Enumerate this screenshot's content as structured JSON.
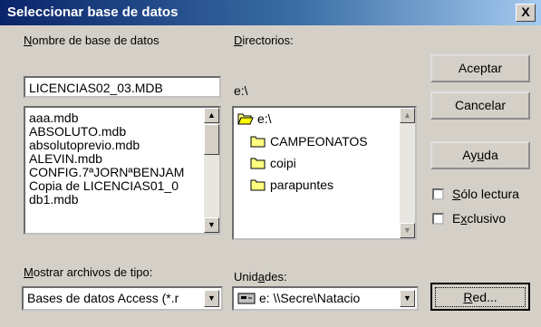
{
  "window": {
    "title": "Seleccionar base de datos",
    "close_label": "X"
  },
  "labels": {
    "db_name_u": "N",
    "db_name_rest": "ombre de base de datos",
    "dirs_u": "D",
    "dirs_rest": "irectorios:",
    "filetype_u": "M",
    "filetype_rest": "ostrar archivos de tipo:",
    "drives_pre": "Unid",
    "drives_u": "a",
    "drives_post": "des:"
  },
  "db_name_field": {
    "value": "LICENCIAS02_03.MDB"
  },
  "current_dir": "e:\\",
  "file_list": [
    "aaa.mdb",
    "ABSOLUTO.mdb",
    "absolutoprevio.mdb",
    "ALEVIN.mdb",
    "CONFIG.7ªJORNªBENJAM",
    "Copia de LICENCIAS01_0",
    "db1.mdb"
  ],
  "directories": [
    {
      "name": "e:\\",
      "icon": "open-folder-icon"
    },
    {
      "name": "CAMPEONATOS",
      "icon": "folder-icon"
    },
    {
      "name": "coipi",
      "icon": "folder-icon"
    },
    {
      "name": "parapuntes",
      "icon": "folder-icon"
    }
  ],
  "filetype_combo": {
    "value": "Bases de datos Access (*.r"
  },
  "drive_combo": {
    "value": "e: \\\\Secre\\Natacio",
    "icon": "network-drive-icon"
  },
  "buttons": {
    "accept": "Aceptar",
    "cancel": "Cancelar",
    "help_pre": "Ay",
    "help_u": "u",
    "help_post": "da",
    "network_u": "R",
    "network_rest": "ed..."
  },
  "checkboxes": {
    "readonly_u": "S",
    "readonly_rest": "ólo lectura",
    "readonly_checked": false,
    "exclusive_pre": "E",
    "exclusive_u": "x",
    "exclusive_post": "clusivo",
    "exclusive_checked": false
  },
  "colors": {
    "title_start": "#0a246a",
    "title_end": "#a6caf0",
    "face": "#d4d0c8"
  }
}
